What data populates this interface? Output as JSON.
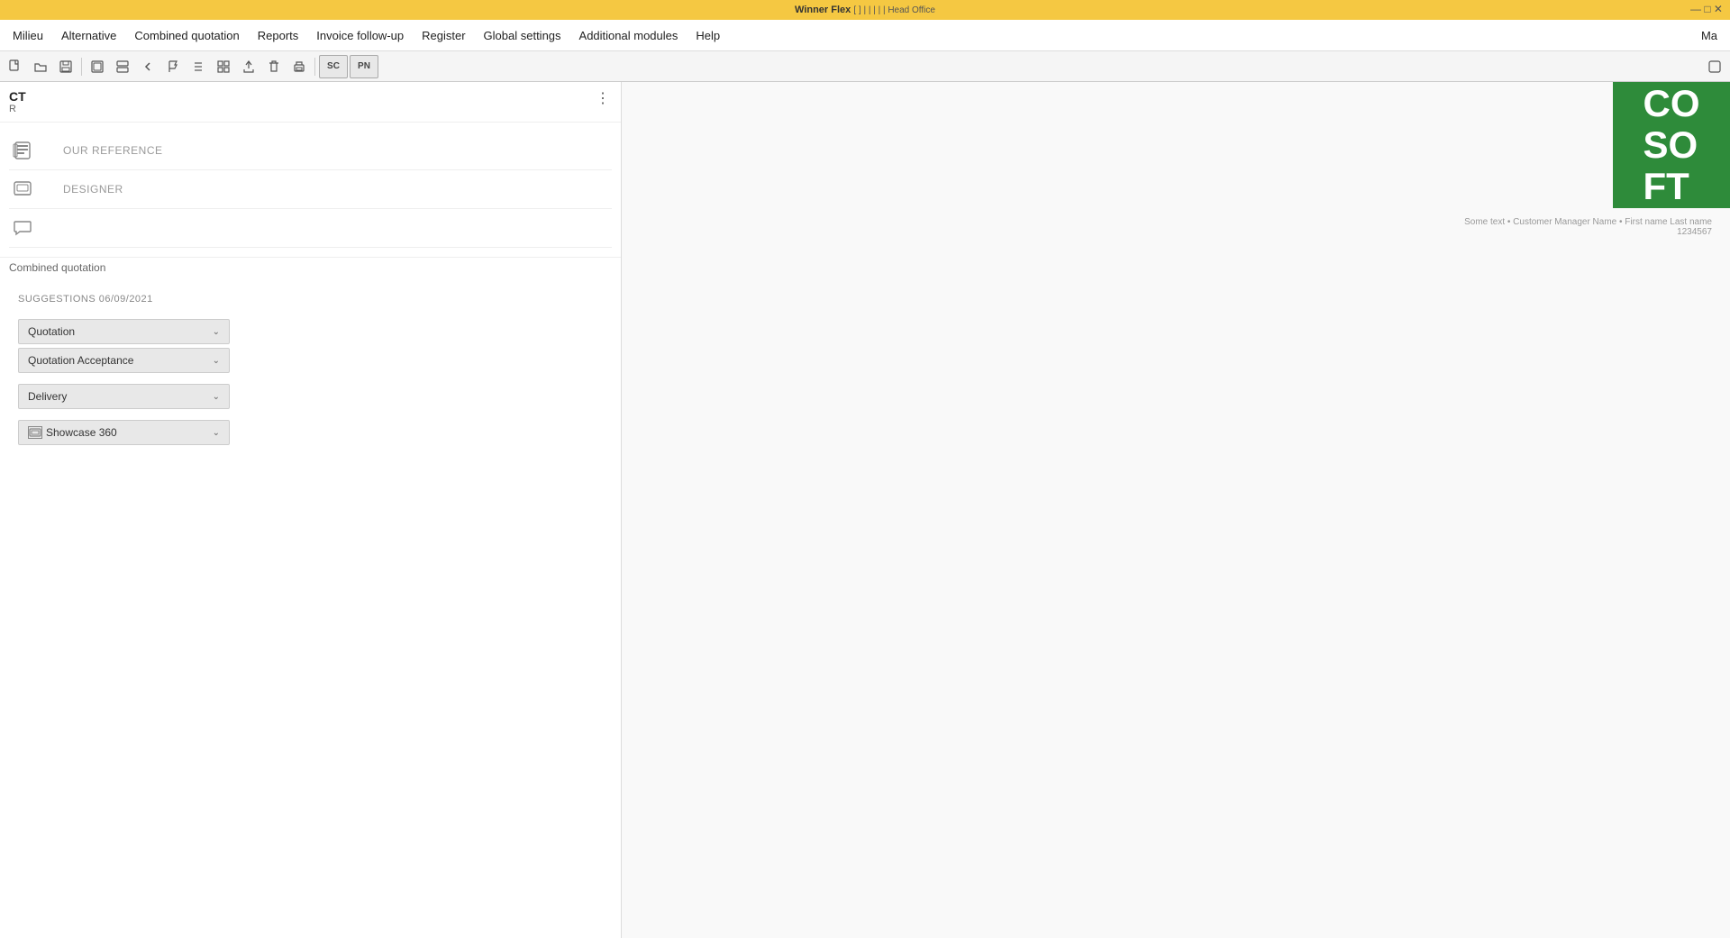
{
  "titlebar": {
    "text": "Winner Flex",
    "details": "[ ] | | | | | Head Office",
    "close": "—  □  ✕"
  },
  "menu": {
    "items": [
      "Milieu",
      "Alternative",
      "Combined quotation",
      "Reports",
      "Invoice follow-up",
      "Register",
      "Global settings",
      "Additional modules",
      "Help",
      "Ma"
    ]
  },
  "toolbar": {
    "buttons": [
      {
        "name": "new",
        "icon": "📄"
      },
      {
        "name": "open",
        "icon": "📂"
      },
      {
        "name": "save",
        "icon": "💾"
      },
      {
        "name": "copy",
        "icon": "⊡"
      },
      {
        "name": "cut",
        "icon": "✄"
      },
      {
        "name": "back",
        "icon": "◀"
      },
      {
        "name": "flag",
        "icon": "⚑"
      },
      {
        "name": "list",
        "icon": "☰"
      },
      {
        "name": "grid",
        "icon": "⊞"
      },
      {
        "name": "export",
        "icon": "↗"
      },
      {
        "name": "trash",
        "icon": "🗑"
      },
      {
        "name": "print",
        "icon": "🖨"
      },
      {
        "name": "sc",
        "icon": "SC"
      },
      {
        "name": "pn",
        "icon": "PN"
      },
      {
        "name": "close-small",
        "icon": "✕"
      }
    ]
  },
  "ct": {
    "title": "CT",
    "subtitle": "R"
  },
  "form": {
    "reference_label": "OUR REFERENCE",
    "designer_label": "DESIGNER",
    "combined_quotation": "Combined quotation"
  },
  "suggestions": {
    "header": "SUGGESTIONS 06/09/2021",
    "buttons": [
      {
        "label": "Quotation",
        "has_icon": false
      },
      {
        "label": "Quotation Acceptance",
        "has_icon": false
      },
      {
        "label": "Delivery",
        "has_icon": false
      },
      {
        "label": "Showcase 360",
        "has_icon": true
      }
    ]
  },
  "logo": {
    "lines": [
      "CO",
      "SO",
      "FT"
    ]
  },
  "address": {
    "line1": "Some text • Customer Manager Name • First name Last name",
    "line2": "1234567"
  },
  "three_dot": "⋮"
}
